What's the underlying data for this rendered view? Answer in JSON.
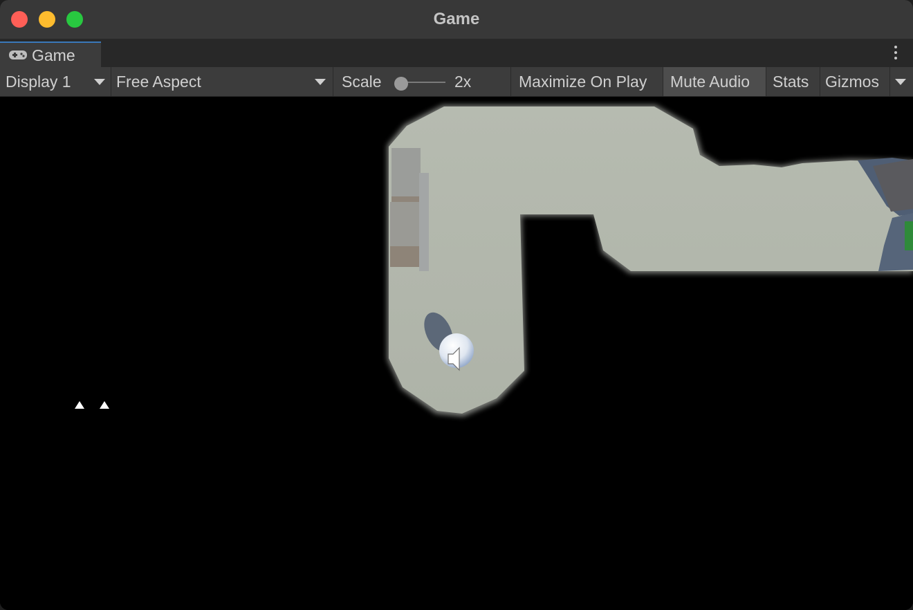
{
  "window": {
    "title": "Game"
  },
  "tab": {
    "label": "Game",
    "icon": "gamepad-icon"
  },
  "toolbar": {
    "display": "Display 1",
    "aspect": "Free Aspect",
    "scale_label": "Scale",
    "scale_value": "2x",
    "scale_slider_fraction": 0.0,
    "maximize_on_play": "Maximize On Play",
    "mute_audio": "Mute Audio",
    "stats": "Stats",
    "gizmos": "Gizmos"
  },
  "colors": {
    "titlebar": "#383838",
    "toolbar": "#3c3c3c",
    "floor": "#b3b8ab",
    "accent_tab": "#3a79bb"
  }
}
